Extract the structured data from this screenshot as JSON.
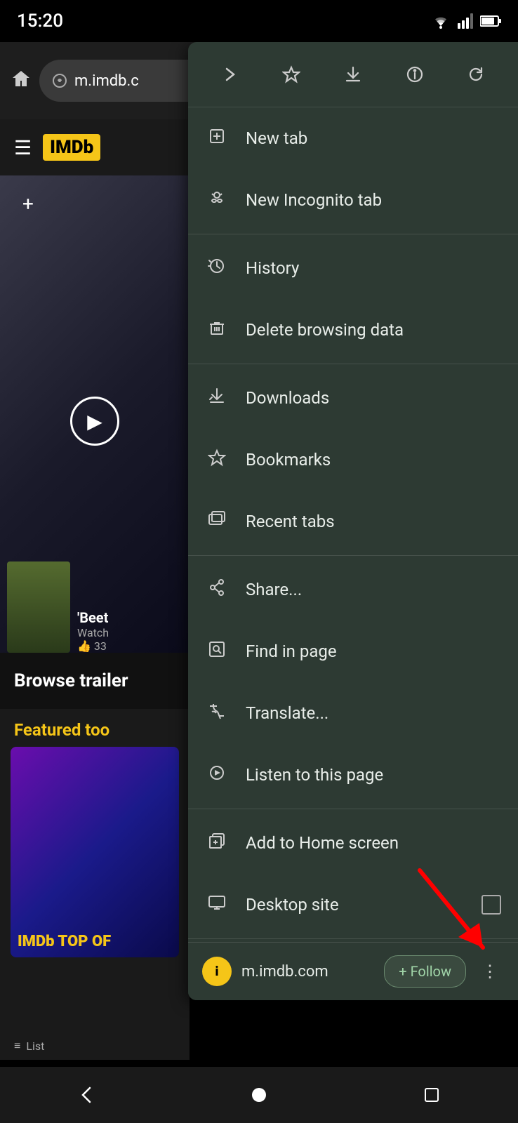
{
  "statusBar": {
    "time": "15:20",
    "wifiIcon": "wifi",
    "signalIcon": "signal",
    "batteryIcon": "battery"
  },
  "browser": {
    "addressText": "m.imdb.c",
    "homeIcon": "⌂"
  },
  "imdb": {
    "logo": "IMDb",
    "headerMenu": "☰"
  },
  "page": {
    "browseText": "Browse trailer",
    "featuredTitle": "Featured too",
    "movieTitle": "'Beet",
    "movieSubtitle": "Watch",
    "movieLikes": "33"
  },
  "menu": {
    "toolbar": {
      "forwardIcon": "→",
      "starIcon": "☆",
      "downloadIcon": "⬇",
      "infoIcon": "ⓘ",
      "refreshIcon": "↻"
    },
    "items": [
      {
        "id": "new-tab",
        "label": "New tab",
        "icon": "new-tab-icon"
      },
      {
        "id": "new-incognito-tab",
        "label": "New Incognito tab",
        "icon": "incognito-icon"
      },
      {
        "id": "history",
        "label": "History",
        "icon": "history-icon"
      },
      {
        "id": "delete-browsing-data",
        "label": "Delete browsing data",
        "icon": "trash-icon"
      },
      {
        "id": "downloads",
        "label": "Downloads",
        "icon": "downloads-icon"
      },
      {
        "id": "bookmarks",
        "label": "Bookmarks",
        "icon": "bookmarks-icon"
      },
      {
        "id": "recent-tabs",
        "label": "Recent tabs",
        "icon": "recent-tabs-icon"
      },
      {
        "id": "share",
        "label": "Share...",
        "icon": "share-icon"
      },
      {
        "id": "find-in-page",
        "label": "Find in page",
        "icon": "find-icon"
      },
      {
        "id": "translate",
        "label": "Translate...",
        "icon": "translate-icon"
      },
      {
        "id": "listen-to-page",
        "label": "Listen to this page",
        "icon": "listen-icon"
      },
      {
        "id": "add-to-home-screen",
        "label": "Add to Home screen",
        "icon": "add-home-icon"
      },
      {
        "id": "desktop-site",
        "label": "Desktop site",
        "icon": "desktop-icon",
        "hasCheckbox": true
      }
    ],
    "followBar": {
      "siteName": "m.imdb.com",
      "followLabel": "+ Follow",
      "siteIconText": "i"
    },
    "dividerAfter": [
      "new-incognito-tab",
      "delete-browsing-data",
      "recent-tabs",
      "listen-to-page",
      "desktop-site"
    ]
  },
  "bottomNav": {
    "backIcon": "◀",
    "homeIcon": "●",
    "recentIcon": "■"
  }
}
